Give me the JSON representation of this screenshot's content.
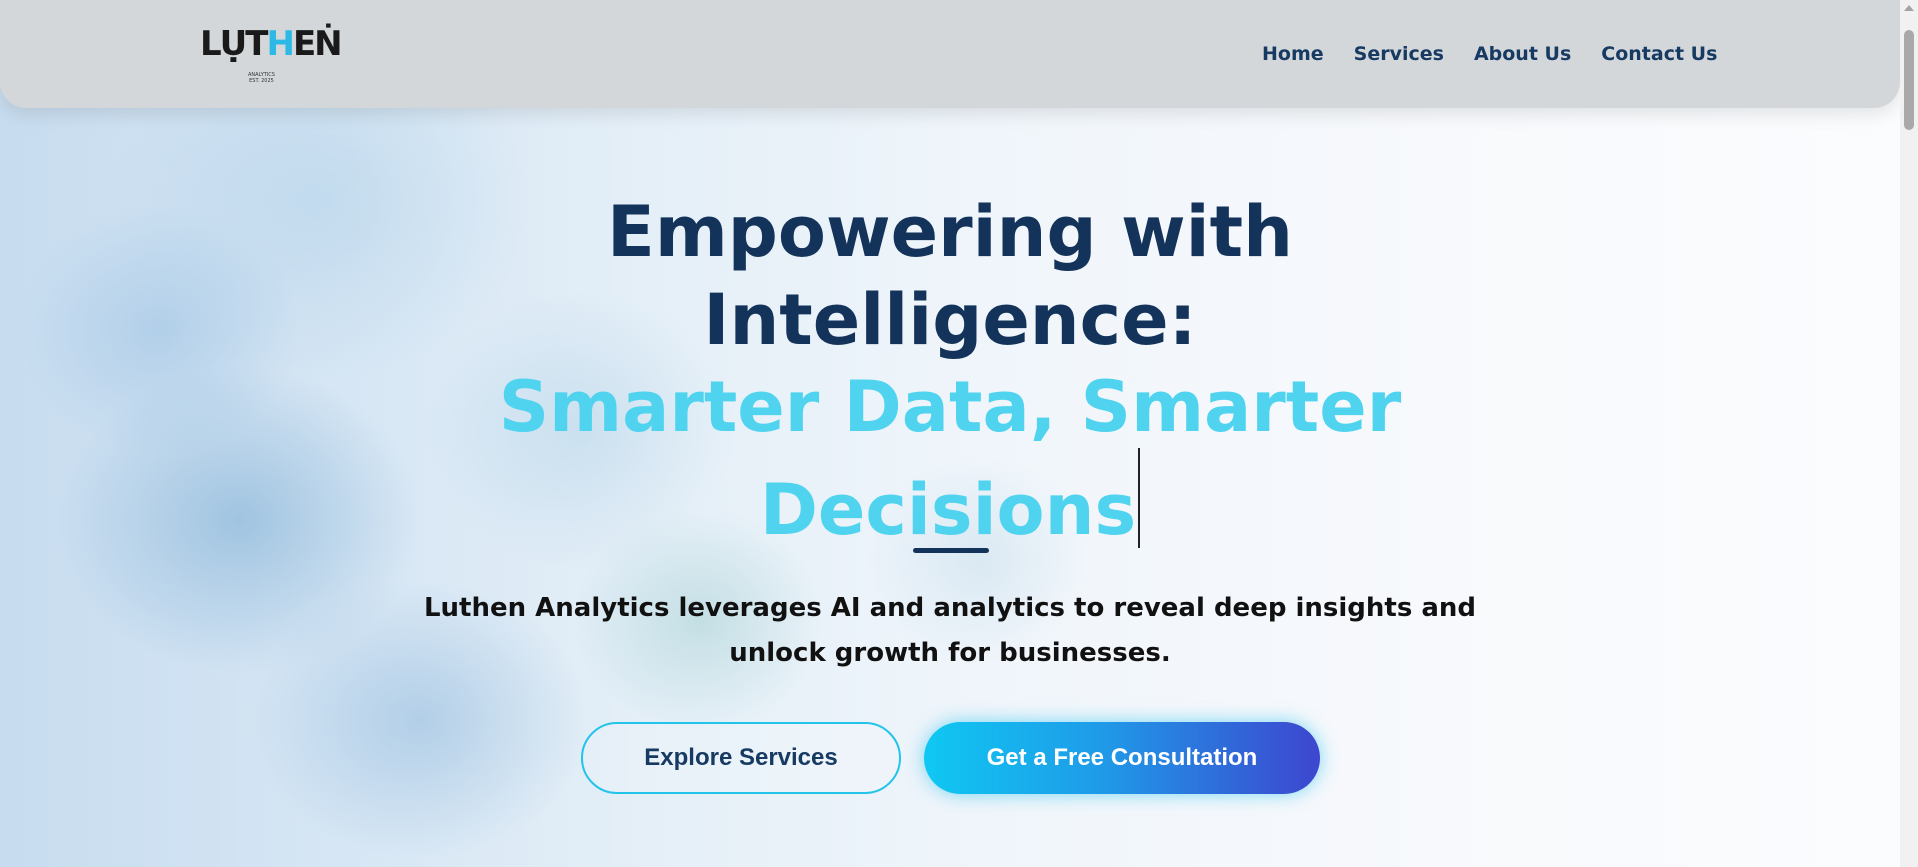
{
  "brand": {
    "logo_text_a": "LỤT",
    "logo_text_b": "H",
    "logo_text_c": "EṄ",
    "logo_tagline": "ANALYTICS\nEST. 2025"
  },
  "nav": {
    "items": [
      {
        "label": "Home"
      },
      {
        "label": "Services"
      },
      {
        "label": "About Us"
      },
      {
        "label": "Contact Us"
      }
    ]
  },
  "hero": {
    "title_line1": "Empowering with",
    "title_line2": "Intelligence:",
    "subtitle_line1": "Smarter Data, Smarter",
    "subtitle_line2": "Decisions",
    "description": "Luthen Analytics leverages AI and analytics to reveal deep insights and unlock growth for businesses.",
    "cta_secondary": "Explore Services",
    "cta_primary": "Get a Free Consultation"
  },
  "colors": {
    "navy": "#14335a",
    "accent": "#4fd3ef",
    "button_gradient_start": "#0fc8f2",
    "button_gradient_end": "#3d46cf",
    "header_bg": "#d4d7da"
  },
  "icons": {
    "scroll_up": "triangle-up-icon"
  }
}
